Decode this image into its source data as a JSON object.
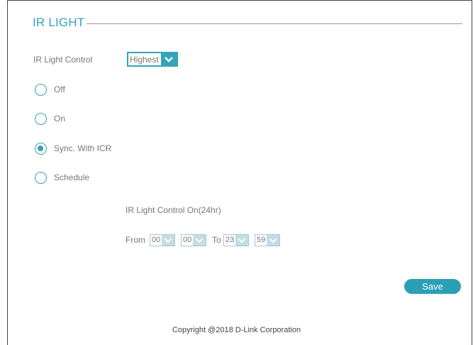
{
  "section": {
    "title": "IR LIGHT"
  },
  "ir_light_control": {
    "label": "IR Light Control",
    "selected": "Highest"
  },
  "modes": [
    {
      "label": "Off",
      "checked": false
    },
    {
      "label": "On",
      "checked": false
    },
    {
      "label": "Sync. With ICR",
      "checked": true
    },
    {
      "label": "Schedule",
      "checked": false
    }
  ],
  "schedule": {
    "title": "IR Light Control On(24hr)",
    "from_label": "From",
    "to_label": "To",
    "from_hour": "00",
    "from_minute": "00",
    "to_hour": "23",
    "to_minute": "59"
  },
  "save_label": "Save",
  "footer": {
    "copyright": "Copyright @2018 D-Link Corporation"
  },
  "colors": {
    "accent": "#35a3b7",
    "button": "#2aa0b5"
  }
}
